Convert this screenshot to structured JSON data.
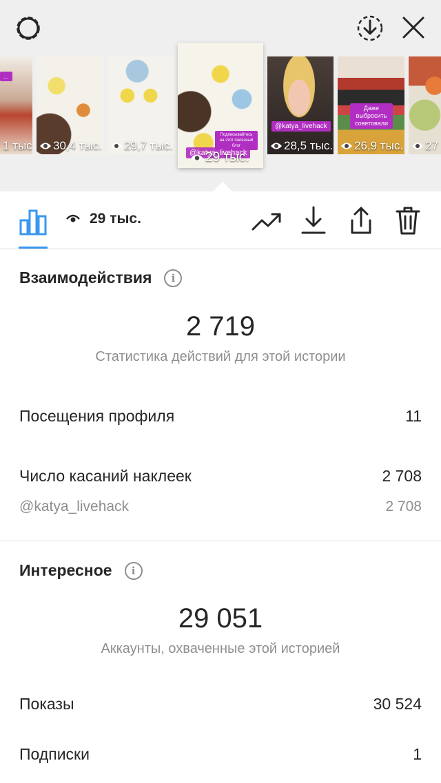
{
  "stories": [
    {
      "views": "1 тыс."
    },
    {
      "views": "30,4 тыс."
    },
    {
      "views": "29,7 тыс."
    },
    {
      "views": "29 тыс.",
      "tag": "@katya_livehack",
      "caption": "Подписывайтесь на этот полезный блог"
    },
    {
      "views": "28,5 тыс.",
      "tag": "@katya_livehack"
    },
    {
      "views": "26,9 тыс.",
      "caption": "Даже выбросить советовали"
    },
    {
      "views": "27"
    }
  ],
  "toolbar": {
    "views": "29 тыс."
  },
  "interactions": {
    "title": "Взаимодействия",
    "total": "2 719",
    "caption": "Статистика действий для этой истории",
    "rows": [
      {
        "label": "Посещения профиля",
        "value": "11"
      },
      {
        "label": "Число касаний наклеек",
        "value": "2 708"
      },
      {
        "label": "@katya_livehack",
        "value": "2 708"
      }
    ]
  },
  "discovery": {
    "title": "Интересное",
    "total": "29 051",
    "caption": "Аккаунты, охваченные этой историей",
    "rows": [
      {
        "label": "Показы",
        "value": "30 524"
      },
      {
        "label": "Подписки",
        "value": "1"
      }
    ]
  },
  "colors": {
    "accent": "#3897f0",
    "tag": "#b12ec2",
    "muted": "#8e8e8e"
  },
  "icons": [
    "settings-icon",
    "save-download-icon",
    "close-icon",
    "eye-icon",
    "bar-chart-icon",
    "trending-icon",
    "download-icon",
    "share-icon",
    "trash-icon",
    "info-icon"
  ]
}
